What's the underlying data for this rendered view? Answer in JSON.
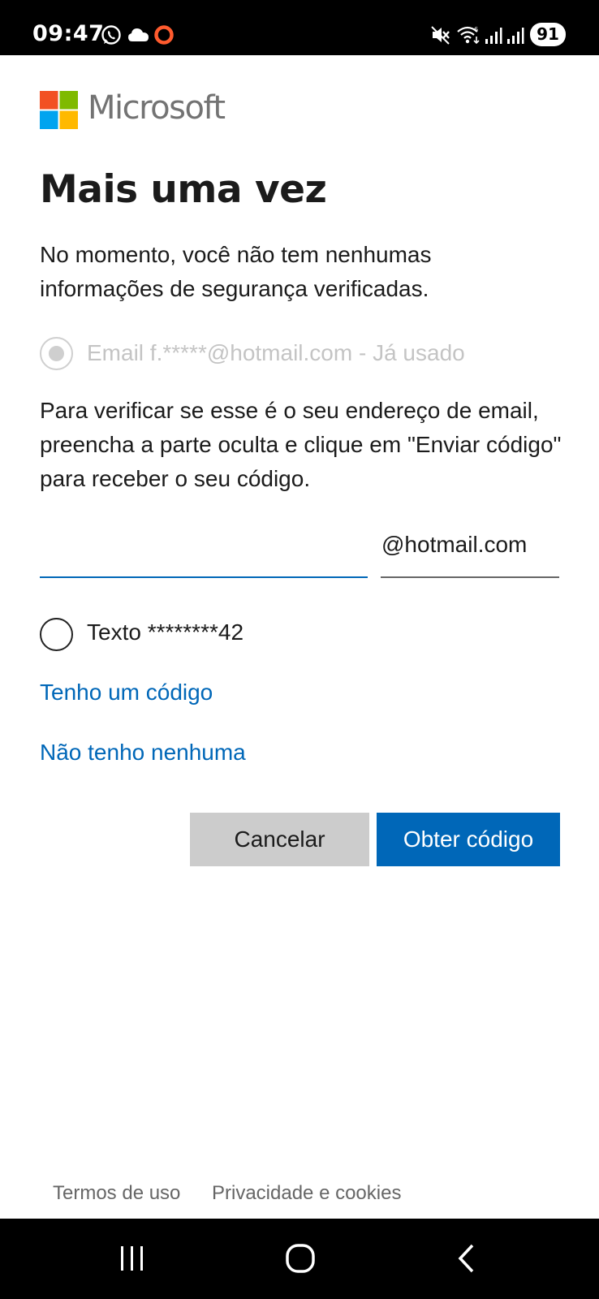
{
  "status_bar": {
    "time": "09:47",
    "battery": "91",
    "icons": [
      "whatsapp-icon",
      "cloud-icon",
      "ring-notification-icon",
      "mute-icon",
      "wifi-icon",
      "signal-icon",
      "signal-icon"
    ]
  },
  "brand": {
    "name": "Microsoft",
    "colors": [
      "#f25022",
      "#7fba00",
      "#00a4ef",
      "#ffb900"
    ]
  },
  "page": {
    "title": "Mais uma vez",
    "intro": "No momento, você não tem nenhumas informações de segurança verificadas."
  },
  "options": {
    "email_option": "Email f.*****@hotmail.com - Já usado",
    "text_option": "Texto ********42"
  },
  "verify": {
    "instructions": "Para verificar se esse é o seu endereço de email, preencha a parte oculta e clique em \"Enviar código\" para receber o seu código.",
    "input_value": "",
    "input_placeholder": "",
    "domain_suffix": "@hotmail.com"
  },
  "links": {
    "have_code": "Tenho um código",
    "have_none": "Não tenho nenhuma"
  },
  "buttons": {
    "cancel": "Cancelar",
    "get_code": "Obter código"
  },
  "footer": {
    "terms": "Termos de uso",
    "privacy": "Privacidade e cookies"
  },
  "colors": {
    "accent": "#0067b8",
    "disabled": "#c4c4c4",
    "secondary_button": "#cccccc"
  }
}
